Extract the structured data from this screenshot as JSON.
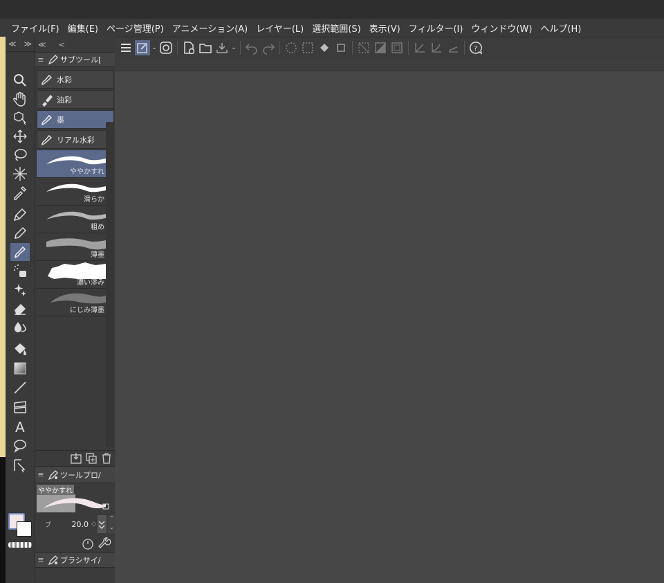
{
  "menu": [
    "ファイル(F)",
    "編集(E)",
    "ページ管理(P)",
    "アニメーション(A)",
    "レイヤー(L)",
    "選択範囲(S)",
    "表示(V)",
    "フィルター(I)",
    "ウィンドウ(W)",
    "ヘルプ(H)"
  ],
  "toolbar": {
    "icons": [
      "menu-icon",
      "pen-mode-icon",
      "swirl-icon",
      "new-file-icon",
      "open-folder-icon",
      "export-icon",
      "undo-icon",
      "redo-icon",
      "marquee-icon",
      "select-icon",
      "fill-icon",
      "crop-icon",
      "deselect-icon",
      "invert-icon",
      "border-icon",
      "ruler-icon",
      "ruler-curve-icon",
      "ruler-tilt-icon",
      "help-icon"
    ]
  },
  "toolcol": {
    "head_left": "≪",
    "head_right": "≫"
  },
  "subtool_panel": {
    "title": "サブツール[",
    "collapse_left": "≪",
    "collapse_back": "<",
    "groups": [
      "水彩",
      "油彩",
      "墨",
      "リアル水彩"
    ],
    "active_group_index": 2,
    "brushes": [
      "ややかすれ",
      "滑らか",
      "粗め",
      "薄墨",
      "濃い滲み",
      "にじみ薄墨"
    ],
    "active_brush_index": 0
  },
  "tool_property": {
    "title": "ツールプロ/",
    "brush_name": "ややかすれ",
    "param_label": "ブ",
    "param_value": "20.0"
  },
  "brush_size": {
    "title": "ブラシサイ/"
  },
  "colors": {
    "accent": "#5b6a8a",
    "main_color": "#f3e6ea",
    "sub_color": "#ffffff"
  }
}
